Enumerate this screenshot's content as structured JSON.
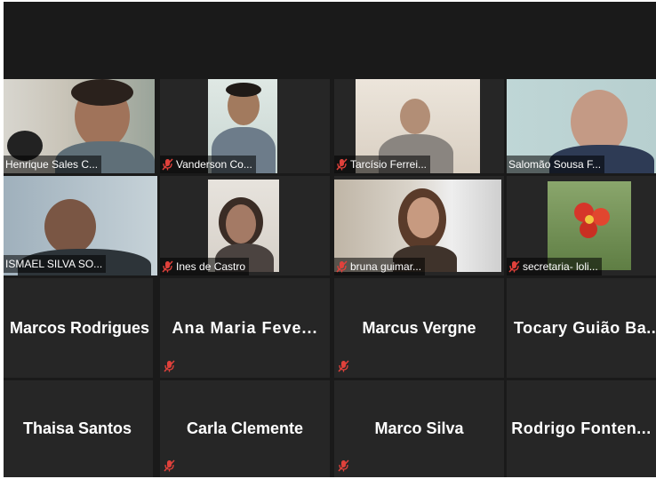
{
  "participants_video": [
    {
      "name": "Henrique Sales C...",
      "muted": false
    },
    {
      "name": "Vanderson Co...",
      "muted": true
    },
    {
      "name": "Tarcísio Ferrei...",
      "muted": true
    },
    {
      "name": "Salomão Sousa F...",
      "muted": false
    },
    {
      "name": "ISMAEL SILVA SO...",
      "muted": false,
      "active_speaker": true
    },
    {
      "name": "Ines de Castro",
      "muted": true
    },
    {
      "name": "bruna guimar...",
      "muted": true
    },
    {
      "name": "secretaria- loli...",
      "muted": true
    }
  ],
  "participants_no_video": [
    {
      "name": "Marcos Rodrigues",
      "muted": false
    },
    {
      "name": "Ana Maria Feve...",
      "muted": true
    },
    {
      "name": "Marcus Vergne",
      "muted": true
    },
    {
      "name": "Tocary Guião Ba...",
      "muted": false
    },
    {
      "name": "Thaisa Santos",
      "muted": false
    },
    {
      "name": "Carla Clemente",
      "muted": true
    },
    {
      "name": "Marco Silva",
      "muted": true
    },
    {
      "name": "Rodrigo Fonten...",
      "muted": false
    }
  ],
  "colors": {
    "background": "#1a1a1a",
    "tile": "#262626",
    "active_speaker_border": "#c7dd5a",
    "muted_icon": "#e0413b"
  },
  "icons": {
    "muted": "mic-muted-icon"
  }
}
